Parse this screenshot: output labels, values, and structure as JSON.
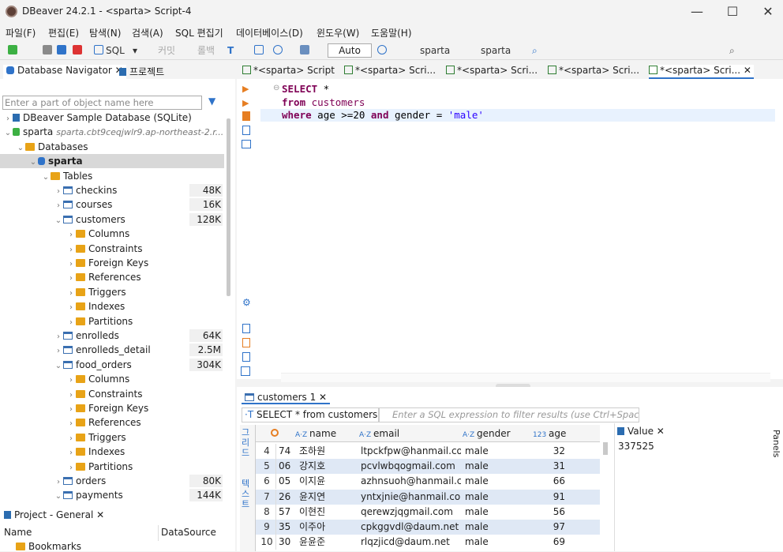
{
  "titlebar": {
    "title": "DBeaver 24.2.1 - <sparta> Script-4",
    "min": "—",
    "max": "☐",
    "close": "✕"
  },
  "menu": [
    "파일(F)",
    "편집(E)",
    "탐색(N)",
    "검색(A)",
    "SQL 편집기",
    "데이터베이스(D)",
    "윈도우(W)",
    "도움말(H)"
  ],
  "toolbar": {
    "sql": "SQL",
    "commit": "커밋",
    "rollback": "롤백",
    "auto": "Auto",
    "conn": "sparta",
    "schema": "sparta"
  },
  "navigator": {
    "tab1": "Database Navigator",
    "tab2": "프로젝트",
    "filter_placeholder": "Enter a part of object name here",
    "tree": [
      {
        "label": "DBeaver Sample Database (SQLite)",
        "indent": 0,
        "caret": "›",
        "icon": "bl"
      },
      {
        "label": "sparta",
        "sub": "sparta.cbt9ceqjwlr9.ap-northeast-2.r...",
        "indent": 0,
        "caret": "⌄",
        "icon": "green"
      },
      {
        "label": "Databases",
        "indent": 1,
        "caret": "⌄",
        "icon": "fold"
      },
      {
        "label": "sparta",
        "indent": 2,
        "caret": "⌄",
        "icon": "db",
        "sel": true
      },
      {
        "label": "Tables",
        "indent": 3,
        "caret": "⌄",
        "icon": "fold"
      },
      {
        "label": "checkins",
        "indent": 4,
        "caret": "›",
        "icon": "tbl",
        "size": "48K"
      },
      {
        "label": "courses",
        "indent": 4,
        "caret": "›",
        "icon": "tbl",
        "size": "16K"
      },
      {
        "label": "customers",
        "indent": 4,
        "caret": "⌄",
        "icon": "tbl",
        "size": "128K"
      },
      {
        "label": "Columns",
        "indent": 5,
        "caret": "›",
        "icon": "fold"
      },
      {
        "label": "Constraints",
        "indent": 5,
        "caret": "›",
        "icon": "fold"
      },
      {
        "label": "Foreign Keys",
        "indent": 5,
        "caret": "›",
        "icon": "fold"
      },
      {
        "label": "References",
        "indent": 5,
        "caret": "›",
        "icon": "fold"
      },
      {
        "label": "Triggers",
        "indent": 5,
        "caret": "›",
        "icon": "fold"
      },
      {
        "label": "Indexes",
        "indent": 5,
        "caret": "›",
        "icon": "fold"
      },
      {
        "label": "Partitions",
        "indent": 5,
        "caret": "›",
        "icon": "fold"
      },
      {
        "label": "enrolleds",
        "indent": 4,
        "caret": "›",
        "icon": "tbl",
        "size": "64K"
      },
      {
        "label": "enrolleds_detail",
        "indent": 4,
        "caret": "›",
        "icon": "tbl",
        "size": "2.5M"
      },
      {
        "label": "food_orders",
        "indent": 4,
        "caret": "⌄",
        "icon": "tbl",
        "size": "304K"
      },
      {
        "label": "Columns",
        "indent": 5,
        "caret": "›",
        "icon": "fold"
      },
      {
        "label": "Constraints",
        "indent": 5,
        "caret": "›",
        "icon": "fold"
      },
      {
        "label": "Foreign Keys",
        "indent": 5,
        "caret": "›",
        "icon": "fold"
      },
      {
        "label": "References",
        "indent": 5,
        "caret": "›",
        "icon": "fold"
      },
      {
        "label": "Triggers",
        "indent": 5,
        "caret": "›",
        "icon": "fold"
      },
      {
        "label": "Indexes",
        "indent": 5,
        "caret": "›",
        "icon": "fold"
      },
      {
        "label": "Partitions",
        "indent": 5,
        "caret": "›",
        "icon": "fold"
      },
      {
        "label": "orders",
        "indent": 4,
        "caret": "›",
        "icon": "tbl",
        "size": "80K"
      },
      {
        "label": "payments",
        "indent": 4,
        "caret": "⌄",
        "icon": "tbl",
        "size": "144K"
      }
    ]
  },
  "project": {
    "tab": "Project - General",
    "col1": "Name",
    "col2": "DataSource",
    "item": "Bookmarks"
  },
  "editor_tabs": [
    "*<sparta> Script",
    "*<sparta> Scri...",
    "*<sparta> Scri...",
    "*<sparta> Scri...",
    "*<sparta> Scri..."
  ],
  "sql": {
    "l1_kw": "SELECT",
    "l1_rest": " *",
    "l2_kw": "from",
    "l2_id": " customers",
    "l3_kw1": "where",
    "l3_a": " age >=20 ",
    "l3_kw2": "and",
    "l3_b": " gender = ",
    "l3_str": "'male'"
  },
  "results": {
    "tab": "customers 1",
    "query": "SELECT * from customers wl",
    "filter_placeholder": "Enter a SQL expression to filter results (use Ctrl+Space)",
    "columns": [
      "name",
      "email",
      "gender",
      "age"
    ],
    "rows": [
      {
        "n": "4",
        "id": "74",
        "name": "조하원",
        "email": "ltpckfpw@hanmail.com",
        "gender": "male",
        "age": "32"
      },
      {
        "n": "5",
        "id": "06",
        "name": "강지호",
        "email": "pcvlwbqogmail.com",
        "gender": "male",
        "age": "31"
      },
      {
        "n": "6",
        "id": "05",
        "name": "이지윤",
        "email": "azhnsuoh@hanmail.com",
        "gender": "male",
        "age": "66"
      },
      {
        "n": "7",
        "id": "26",
        "name": "윤지연",
        "email": "yntxjnie@hanmail.com",
        "gender": "male",
        "age": "91"
      },
      {
        "n": "8",
        "id": "57",
        "name": "이현진",
        "email": "qerewzjqgmail.com",
        "gender": "male",
        "age": "56"
      },
      {
        "n": "9",
        "id": "35",
        "name": "이주아",
        "email": "cpkggvdl@daum.net",
        "gender": "male",
        "age": "97"
      },
      {
        "n": "10",
        "id": "30",
        "name": "윤윤준",
        "email": "rlqzjicd@daum.net",
        "gender": "male",
        "age": "69"
      }
    ],
    "value_tab": "Value",
    "value": "337525",
    "panels": "Panels",
    "side_label1": "그리드",
    "side_label2": "텍스트"
  }
}
